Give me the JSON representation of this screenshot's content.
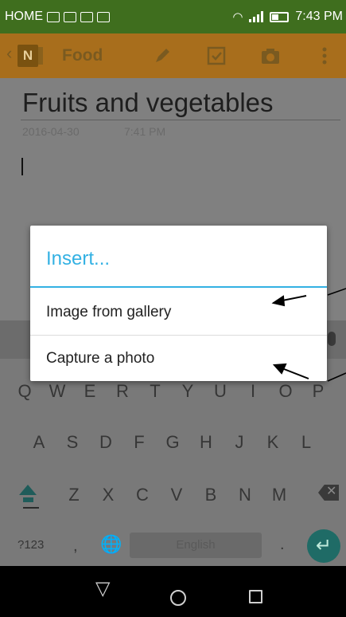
{
  "status_bar": {
    "carrier_label": "HOME",
    "time": "7:43 PM"
  },
  "app_bar": {
    "logo_letter": "N",
    "title": "Food",
    "icons": [
      "pencil-icon",
      "checkbox-icon",
      "camera-icon",
      "overflow-menu-icon"
    ]
  },
  "note": {
    "title": "Fruits and vegetables",
    "date": "2016-04-30",
    "time": "7:41 PM"
  },
  "dialog": {
    "title": "Insert...",
    "items": [
      {
        "label": "Image from gallery"
      },
      {
        "label": "Capture a photo"
      }
    ]
  },
  "keyboard": {
    "row1": [
      "Q",
      "W",
      "E",
      "R",
      "T",
      "Y",
      "U",
      "I",
      "O",
      "P"
    ],
    "row2": [
      "A",
      "S",
      "D",
      "F",
      "G",
      "H",
      "J",
      "K",
      "L"
    ],
    "row3": [
      "Z",
      "X",
      "C",
      "V",
      "B",
      "N",
      "M"
    ],
    "symbols_key": "?123",
    "comma_key": ",",
    "period_key": ".",
    "space_label": "English"
  },
  "colors": {
    "status_bar": "#3f6e1e",
    "app_bar": "#a86e1c",
    "accent": "#33b1e3",
    "enter_key": "#1f6b66"
  }
}
